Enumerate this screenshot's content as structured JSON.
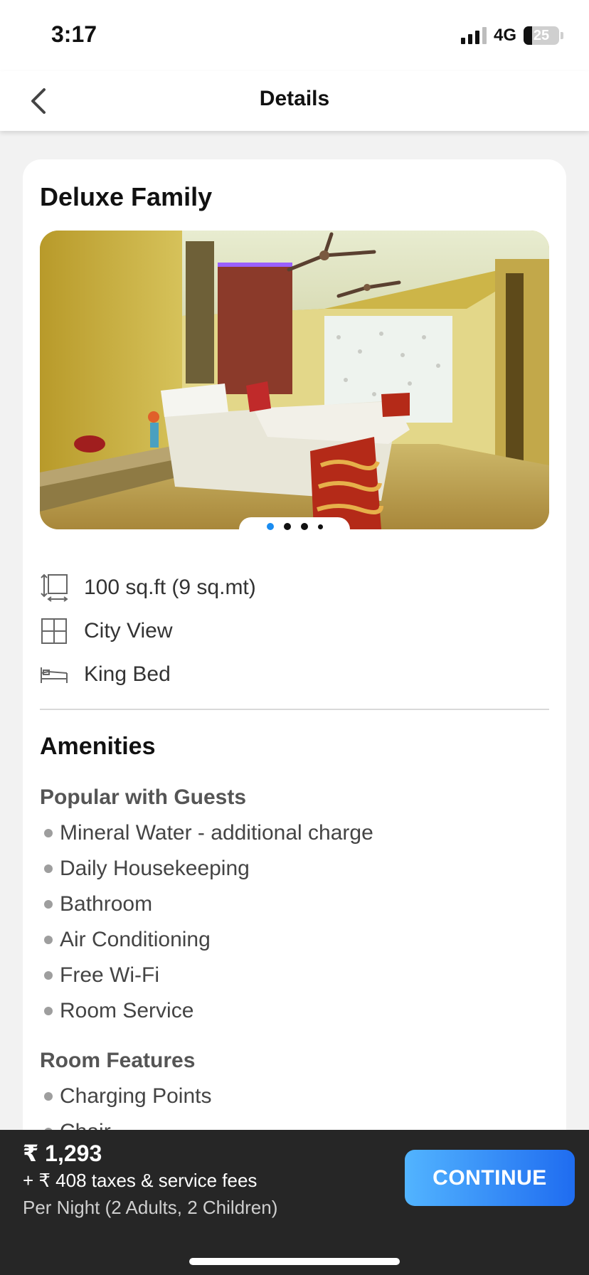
{
  "status_bar": {
    "time": "3:17",
    "network": "4G",
    "battery": "25"
  },
  "nav": {
    "title": "Details",
    "back_icon": "chevron-left-icon"
  },
  "room": {
    "name": "Deluxe Family",
    "photo_count": 4,
    "active_photo_index": 0,
    "features": [
      {
        "icon": "room-size-icon",
        "label": "100 sq.ft (9 sq.mt)"
      },
      {
        "icon": "window-icon",
        "label": "City View"
      },
      {
        "icon": "bed-icon",
        "label": "King Bed"
      }
    ]
  },
  "amenities": {
    "title": "Amenities",
    "groups": [
      {
        "title": "Popular with Guests",
        "items": [
          "Mineral Water - additional charge",
          "Daily Housekeeping",
          "Bathroom",
          "Air Conditioning",
          "Free Wi-Fi",
          "Room Service"
        ]
      },
      {
        "title": "Room Features",
        "items": [
          "Charging Points",
          "Chair"
        ]
      }
    ]
  },
  "footer": {
    "price": "₹ 1,293",
    "taxes": "+ ₹ 408 taxes & service fees",
    "per_night": "Per Night (2 Adults, 2 Children)",
    "continue_label": "CONTINUE"
  },
  "colors": {
    "accent": "#1a8cf0",
    "button_gradient_start": "#52b4ff",
    "button_gradient_end": "#1f6cf0",
    "footer_bg": "#262626"
  }
}
